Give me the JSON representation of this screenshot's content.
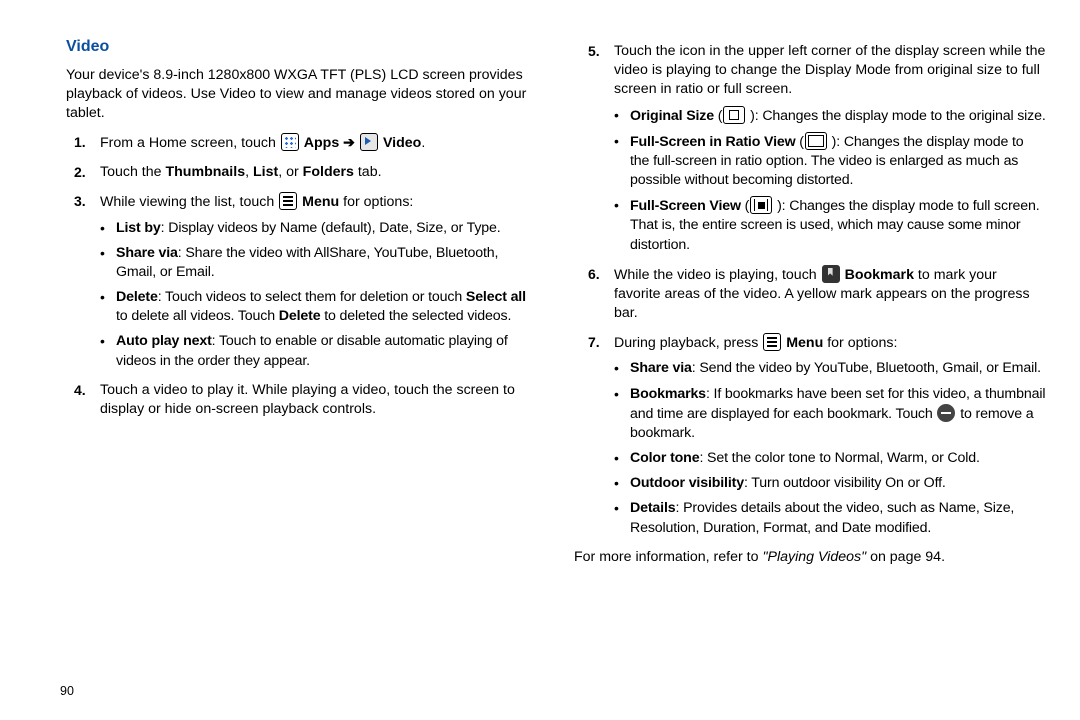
{
  "title": "Video",
  "intro": "Your device's 8.9-inch 1280x800 WXGA TFT (PLS) LCD screen provides playback of videos. Use Video to view and manage videos stored on your tablet.",
  "steps_left": {
    "s1": {
      "pre": "From a Home screen, touch ",
      "apps": "Apps",
      "arrow": " ➔ ",
      "video": "Video",
      "post": "."
    },
    "s2": {
      "pre": "Touch the ",
      "t1": "Thumbnails",
      "c1": ", ",
      "t2": "List",
      "c2": ", or ",
      "t3": "Folders",
      "post": " tab."
    },
    "s3": {
      "pre": "While viewing the list, touch ",
      "menu": "Menu",
      "post": " for options:"
    },
    "s3_sub": {
      "a": {
        "b": "List by",
        "t": ": Display videos by Name (default), Date, Size, or Type."
      },
      "b": {
        "b": "Share via",
        "t": ": Share the video with AllShare, YouTube, Bluetooth, Gmail, or Email."
      },
      "c": {
        "b": "Delete",
        "t1": ": Touch videos to select them for deletion or touch ",
        "b2": "Select all",
        "t2": " to delete all videos. Touch ",
        "b3": "Delete",
        "t3": " to deleted the selected videos."
      },
      "d": {
        "b": "Auto play next",
        "t": ": Touch to enable or disable automatic playing of videos in the order they appear."
      }
    },
    "s4": "Touch a video to play it. While playing a video, touch the screen to display or hide on-screen playback controls."
  },
  "steps_right": {
    "s5": "Touch the icon in the upper left corner of the display screen while the video is playing to change the Display Mode from original size to full screen in ratio or full screen.",
    "s5_sub": {
      "a": {
        "b": "Original Size",
        "t": "): Changes the display mode to the original size."
      },
      "b": {
        "b": "Full-Screen in Ratio View",
        "t": "): Changes the display mode to the full-screen in ratio option. The video is enlarged as much as possible without becoming distorted."
      },
      "c": {
        "b": "Full-Screen View",
        "t": "): Changes the display mode to full screen. That is, the entire screen is used, which may cause some minor distortion."
      }
    },
    "s6": {
      "pre": "While the video is playing, touch ",
      "bm": "Bookmark",
      "post": " to mark your favorite areas of the video. A yellow mark appears on the progress bar."
    },
    "s7": {
      "pre": "During playback, press ",
      "menu": "Menu",
      "post": " for options:"
    },
    "s7_sub": {
      "a": {
        "b": "Share via",
        "t": ": Send the video by YouTube, Bluetooth, Gmail, or Email."
      },
      "b": {
        "b": "Bookmarks",
        "t1": ": If bookmarks have been set for this video, a thumbnail and time are displayed for each bookmark. Touch ",
        "t2": " to remove a bookmark."
      },
      "c": {
        "b": "Color tone",
        "t": ": Set the color tone to Normal, Warm, or Cold."
      },
      "d": {
        "b": "Outdoor visibility",
        "t": ": Turn outdoor visibility On or Off."
      },
      "e": {
        "b": "Details",
        "t": ": Provides details about the video, such as Name, Size, Resolution, Duration, Format, and Date modified."
      }
    }
  },
  "ref": {
    "pre": "For more information, refer to ",
    "link": "\"Playing Videos\"",
    "post": "  on page 94."
  },
  "pagenum": "90",
  "paren_open": " (",
  "paren_space": " "
}
